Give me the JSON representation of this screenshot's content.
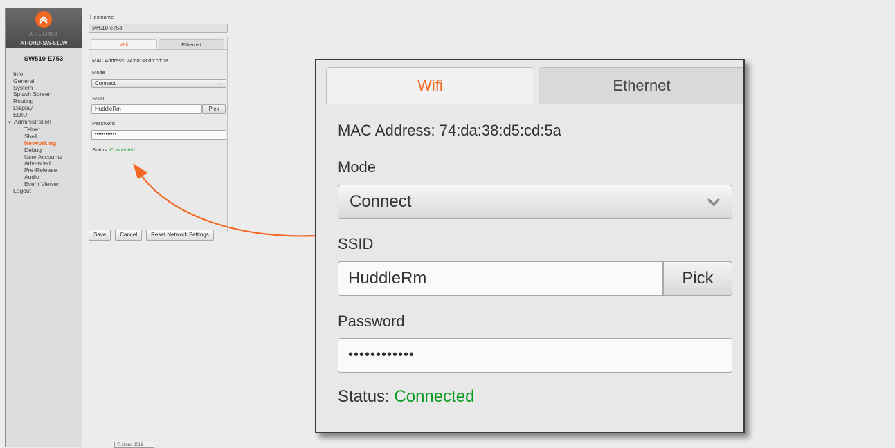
{
  "brand": {
    "wordmark": "ATLONA",
    "model": "AT-UHD-SW-510W",
    "accent": "#f26722",
    "status_color": "#0a9a1f"
  },
  "device_name": "SW510-E753",
  "nav": {
    "items": [
      {
        "label": "Info"
      },
      {
        "label": "General"
      },
      {
        "label": "System"
      },
      {
        "label": "Splash Screen"
      },
      {
        "label": "Routing"
      },
      {
        "label": "Display"
      },
      {
        "label": "EDID"
      },
      {
        "label": "Administration"
      },
      {
        "label": "Telnet"
      },
      {
        "label": "Shell"
      },
      {
        "label": "Networking"
      },
      {
        "label": "Debug"
      },
      {
        "label": "User Accounts"
      },
      {
        "label": "Advanced"
      },
      {
        "label": "Pre-Release"
      },
      {
        "label": "Audio"
      },
      {
        "label": "Event Viewer"
      },
      {
        "label": "Logout"
      }
    ],
    "active": "Networking"
  },
  "form": {
    "hostname_label": "Hostname",
    "hostname_value": "sw510-e753",
    "tabs": [
      {
        "label": "Wifi"
      },
      {
        "label": "Ethernet"
      }
    ],
    "mac": "MAC Address: 74:da:38:d5:cd:5a",
    "mode_label": "Mode",
    "mode_value": "Connect",
    "ssid_label": "SSID",
    "ssid_value": "HuddleRm",
    "pick_label": "Pick",
    "password_label": "Password",
    "password_value": "••••••••••••",
    "status_label": "Status:",
    "status_value": "Connected"
  },
  "buttons": {
    "save": "Save",
    "cancel": "Cancel",
    "reset": "Reset Network Settings"
  },
  "footer_text": "© atlona 2016",
  "icons": {
    "logo": "atlona-chevron-logo",
    "dropdown": "chevron-down-icon",
    "callout": "curved-arrow"
  }
}
